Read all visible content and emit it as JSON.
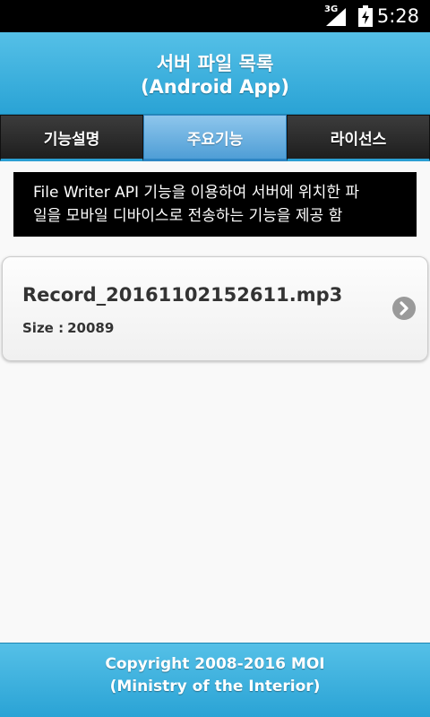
{
  "status_bar": {
    "network": "3G",
    "time": "5:28",
    "icons": [
      "signal-icon",
      "battery-charging-icon"
    ]
  },
  "header": {
    "title_line1": "서버 파일 목록",
    "title_line2": "(Android App)"
  },
  "tabs": [
    {
      "label": "기능설명",
      "active": false
    },
    {
      "label": "주요기능",
      "active": true
    },
    {
      "label": "라이선스",
      "active": false
    }
  ],
  "description": {
    "line1": "File Writer API 기능을 이용하여 서버에 위치한 파",
    "line2": "일을 모바일 디바이스로 전송하는 기능을 제공 함"
  },
  "files": [
    {
      "name": "Record_20161102152611.mp3",
      "size_label": "Size :",
      "size_value": "20089",
      "icon": "chevron-right-circle-icon"
    }
  ],
  "footer": {
    "line1": "Copyright 2008-2016 MOI",
    "line2": "(Ministry of the Interior)"
  },
  "colors": {
    "header_blue": "#2aa3d5",
    "tab_active": "#6db3e2",
    "tab_inactive": "#2a2a2a"
  }
}
